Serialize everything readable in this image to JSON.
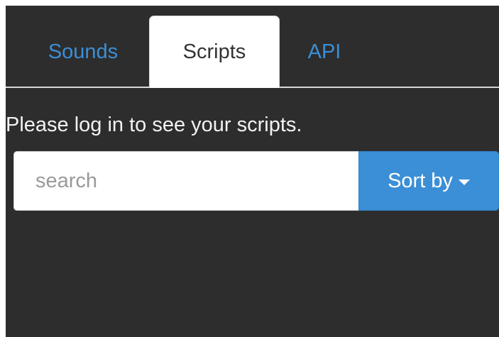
{
  "tabs": [
    {
      "label": "Sounds",
      "active": false
    },
    {
      "label": "Scripts",
      "active": true
    },
    {
      "label": "API",
      "active": false
    }
  ],
  "message": "Please log in to see your scripts.",
  "search": {
    "placeholder": "search",
    "value": ""
  },
  "sort": {
    "label": "Sort by",
    "icon": "caret-down-icon"
  },
  "colors": {
    "panel_background": "#2d2d2d",
    "accent": "#3b8fd6",
    "active_tab_background": "#ffffff",
    "message_text": "#f2f2f2"
  }
}
